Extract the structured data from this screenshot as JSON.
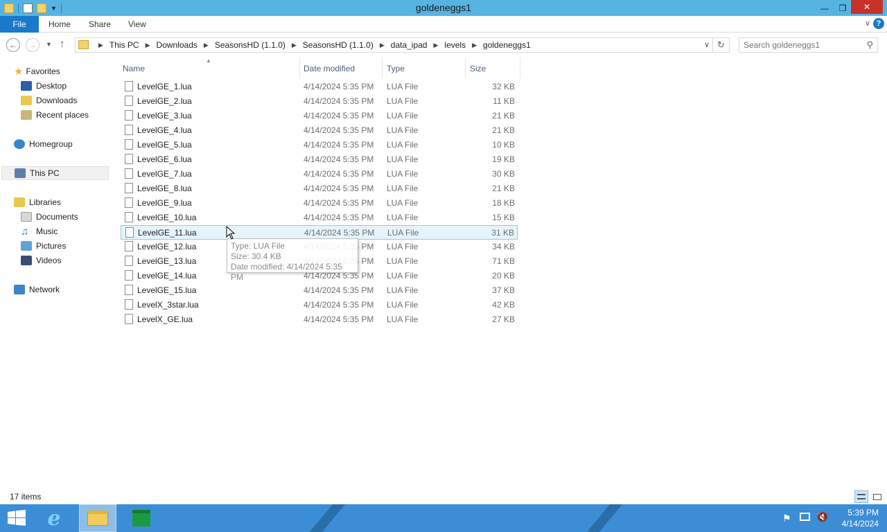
{
  "window": {
    "title": "goldeneggs1"
  },
  "ribbon": {
    "tabs": [
      "File",
      "Home",
      "Share",
      "View"
    ]
  },
  "address": {
    "breadcrumbs": [
      "This PC",
      "Downloads",
      "SeasonsHD (1.1.0)",
      "SeasonsHD (1.1.0)",
      "data_ipad",
      "levels",
      "goldeneggs1"
    ]
  },
  "search": {
    "placeholder": "Search goldeneggs1"
  },
  "navpane": {
    "favorites": "Favorites",
    "desktop": "Desktop",
    "downloads": "Downloads",
    "recent": "Recent places",
    "homegroup": "Homegroup",
    "thispc": "This PC",
    "libraries": "Libraries",
    "documents": "Documents",
    "music": "Music",
    "pictures": "Pictures",
    "videos": "Videos",
    "network": "Network"
  },
  "columns": {
    "name": "Name",
    "date": "Date modified",
    "type": "Type",
    "size": "Size"
  },
  "files": [
    {
      "name": "LevelGE_1.lua",
      "date": "4/14/2024 5:35 PM",
      "type": "LUA File",
      "size": "32 KB"
    },
    {
      "name": "LevelGE_2.lua",
      "date": "4/14/2024 5:35 PM",
      "type": "LUA File",
      "size": "11 KB"
    },
    {
      "name": "LevelGE_3.lua",
      "date": "4/14/2024 5:35 PM",
      "type": "LUA File",
      "size": "21 KB"
    },
    {
      "name": "LevelGE_4.lua",
      "date": "4/14/2024 5:35 PM",
      "type": "LUA File",
      "size": "21 KB"
    },
    {
      "name": "LevelGE_5.lua",
      "date": "4/14/2024 5:35 PM",
      "type": "LUA File",
      "size": "10 KB"
    },
    {
      "name": "LevelGE_6.lua",
      "date": "4/14/2024 5:35 PM",
      "type": "LUA File",
      "size": "19 KB"
    },
    {
      "name": "LevelGE_7.lua",
      "date": "4/14/2024 5:35 PM",
      "type": "LUA File",
      "size": "30 KB"
    },
    {
      "name": "LevelGE_8.lua",
      "date": "4/14/2024 5:35 PM",
      "type": "LUA File",
      "size": "21 KB"
    },
    {
      "name": "LevelGE_9.lua",
      "date": "4/14/2024 5:35 PM",
      "type": "LUA File",
      "size": "18 KB"
    },
    {
      "name": "LevelGE_10.lua",
      "date": "4/14/2024 5:35 PM",
      "type": "LUA File",
      "size": "15 KB"
    },
    {
      "name": "LevelGE_11.lua",
      "date": "4/14/2024 5:35 PM",
      "type": "LUA File",
      "size": "31 KB"
    },
    {
      "name": "LevelGE_12.lua",
      "date": "4/14/2024 5:35 PM",
      "type": "LUA File",
      "size": "34 KB"
    },
    {
      "name": "LevelGE_13.lua",
      "date": "4/14/2024 5:35 PM",
      "type": "LUA File",
      "size": "71 KB"
    },
    {
      "name": "LevelGE_14.lua",
      "date": "4/14/2024 5:35 PM",
      "type": "LUA File",
      "size": "20 KB"
    },
    {
      "name": "LevelGE_15.lua",
      "date": "4/14/2024 5:35 PM",
      "type": "LUA File",
      "size": "37 KB"
    },
    {
      "name": "LevelX_3star.lua",
      "date": "4/14/2024 5:35 PM",
      "type": "LUA File",
      "size": "42 KB"
    },
    {
      "name": "LevelX_GE.lua",
      "date": "4/14/2024 5:35 PM",
      "type": "LUA File",
      "size": "27 KB"
    }
  ],
  "tooltip": {
    "type": "Type: LUA File",
    "size": "Size: 30.4 KB",
    "date": "Date modified: 4/14/2024 5:35 PM"
  },
  "status": {
    "items": "17 items"
  },
  "taskbar": {
    "time": "5:39 PM",
    "date": "4/14/2024"
  },
  "colors": {
    "titlebar": "#56b4e3",
    "file_tab": "#1979ca",
    "close": "#c7312a",
    "taskbar": "#3b8ed6",
    "hover_row": "#e5f3fb"
  },
  "icons": {
    "back": "back-arrow-icon",
    "forward": "forward-arrow-icon",
    "up": "up-arrow-icon",
    "refresh": "refresh-icon",
    "search": "search-icon",
    "file": "file-icon",
    "ie": "internet-explorer-icon",
    "explorer": "file-explorer-icon",
    "store": "store-icon"
  }
}
